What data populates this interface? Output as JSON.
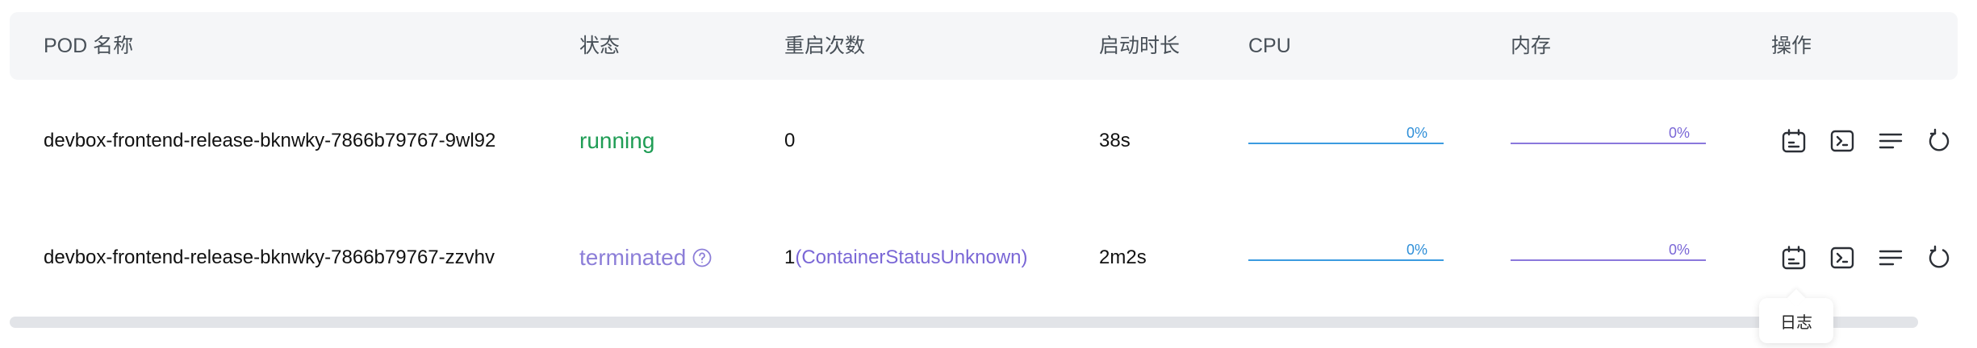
{
  "columns": {
    "name": "POD 名称",
    "status": "状态",
    "restarts": "重启次数",
    "uptime": "启动时长",
    "cpu": "CPU",
    "memory": "内存",
    "actions": "操作"
  },
  "rows": [
    {
      "name": "devbox-frontend-release-bknwky-7866b79767-9wl92",
      "status": "running",
      "restarts": "0",
      "restart_reason": "",
      "uptime": "38s",
      "cpu_label": "0%",
      "cpu_value": 0,
      "memory_label": "0%",
      "memory_value": 0
    },
    {
      "name": "devbox-frontend-release-bknwky-7866b79767-zzvhv",
      "status": "terminated",
      "restarts": "1",
      "restart_reason": "(ContainerStatusUnknown)",
      "uptime": "2m2s",
      "cpu_label": "0%",
      "cpu_value": 0,
      "memory_label": "0%",
      "memory_value": 0
    }
  ],
  "action_icons": [
    "logs-icon",
    "terminal-icon",
    "details-icon",
    "restart-icon"
  ],
  "tooltip": {
    "label": "日志"
  },
  "colors": {
    "running": "#1f9d55",
    "terminated": "#8c7ed8",
    "cpu": "#3b9be0",
    "memory": "#8a78dc"
  }
}
